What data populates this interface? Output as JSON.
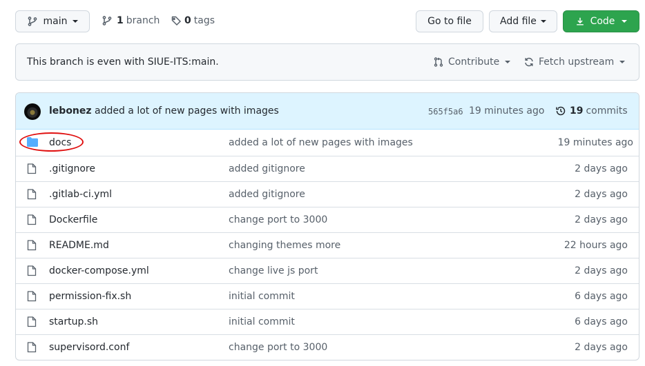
{
  "toolbar": {
    "branch_button": "main",
    "branches_count": "1",
    "branches_label": "branch",
    "tags_count": "0",
    "tags_label": "tags",
    "go_to_file": "Go to file",
    "add_file": "Add file",
    "code": "Code"
  },
  "notice": {
    "text": "This branch is even with SIUE-ITS:main.",
    "contribute": "Contribute",
    "fetch_upstream": "Fetch upstream"
  },
  "latest_commit": {
    "author": "lebonez",
    "message": "added a lot of new pages with images",
    "sha": "565f5a6",
    "time": "19 minutes ago",
    "commits_count": "19",
    "commits_label": "commits"
  },
  "files": [
    {
      "name": "docs",
      "type": "folder",
      "message": "added a lot of new pages with images",
      "time": "19 minutes ago"
    },
    {
      "name": ".gitignore",
      "type": "file",
      "message": "added gitignore",
      "time": "2 days ago"
    },
    {
      "name": ".gitlab-ci.yml",
      "type": "file",
      "message": "added gitignore",
      "time": "2 days ago"
    },
    {
      "name": "Dockerfile",
      "type": "file",
      "message": "change port to 3000",
      "time": "2 days ago"
    },
    {
      "name": "README.md",
      "type": "file",
      "message": "changing themes more",
      "time": "22 hours ago"
    },
    {
      "name": "docker-compose.yml",
      "type": "file",
      "message": "change live js port",
      "time": "2 days ago"
    },
    {
      "name": "permission-fix.sh",
      "type": "file",
      "message": "initial commit",
      "time": "6 days ago"
    },
    {
      "name": "startup.sh",
      "type": "file",
      "message": "initial commit",
      "time": "6 days ago"
    },
    {
      "name": "supervisord.conf",
      "type": "file",
      "message": "change port to 3000",
      "time": "2 days ago"
    }
  ],
  "colors": {
    "primary_green": "#2da44e",
    "commit_bar_bg": "#ddf4ff",
    "folder_icon": "#54aeff",
    "annotation_red": "#e01010"
  }
}
